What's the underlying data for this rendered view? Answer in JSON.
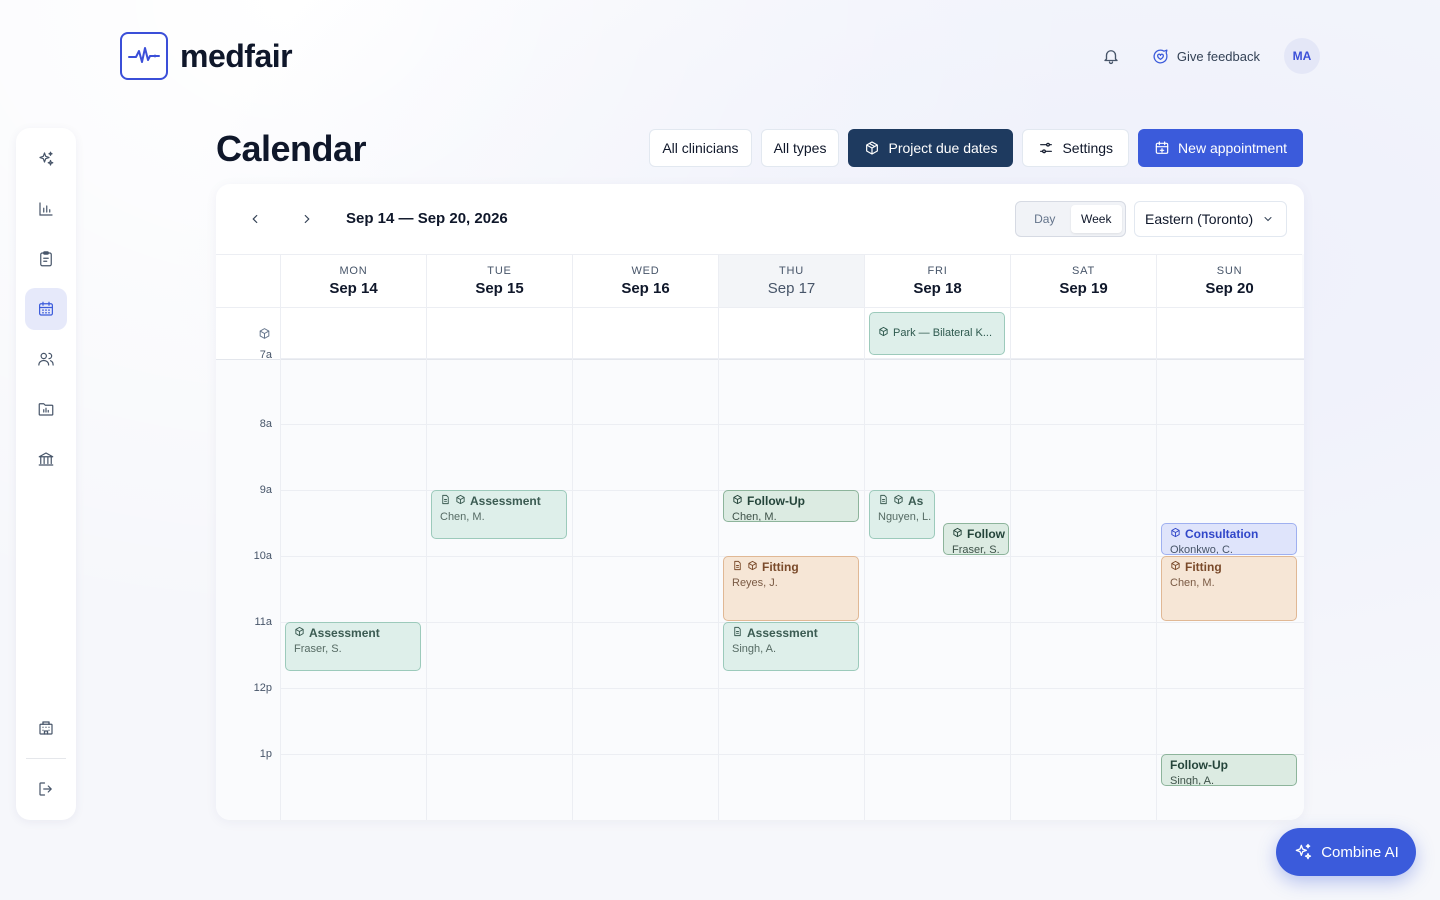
{
  "app": {
    "brand": "medfair"
  },
  "header": {
    "feedback_label": "Give feedback",
    "avatar_initials": "MA"
  },
  "page": {
    "title": "Calendar"
  },
  "toolbar": {
    "clinicians": "All clinicians",
    "types": "All types",
    "project_due": "Project due dates",
    "settings": "Settings",
    "new_appointment": "New appointment"
  },
  "calendar": {
    "range": "Sep 14 — Sep 20, 2026",
    "view_day": "Day",
    "view_week": "Week",
    "active_view": "Week",
    "timezone": "Eastern (Toronto)",
    "days": [
      {
        "name": "MON",
        "date": "Sep 14"
      },
      {
        "name": "TUE",
        "date": "Sep 15"
      },
      {
        "name": "WED",
        "date": "Sep 16"
      },
      {
        "name": "THU",
        "date": "Sep 17",
        "today": true
      },
      {
        "name": "FRI",
        "date": "Sep 18"
      },
      {
        "name": "SAT",
        "date": "Sep 19"
      },
      {
        "name": "SUN",
        "date": "Sep 20"
      }
    ],
    "hours": [
      "7a",
      "8a",
      "9a",
      "10a",
      "11a",
      "12p",
      "1p"
    ],
    "all_day_events": [
      {
        "day": "FRI",
        "title": "Park — Bilateral K..."
      }
    ],
    "events": [
      {
        "day": "MON",
        "title": "Assessment",
        "person": "Fraser, S.",
        "start": "11:00",
        "end": "11:45",
        "color": "teal",
        "icons": [
          "package"
        ]
      },
      {
        "day": "TUE",
        "title": "Assessment",
        "person": "Chen, M.",
        "start": "9:00",
        "end": "9:45",
        "color": "teal",
        "icons": [
          "document",
          "package"
        ]
      },
      {
        "day": "THU",
        "title": "Follow-Up",
        "person": "Chen, M.",
        "start": "9:00",
        "end": "9:30",
        "color": "green",
        "icons": [
          "package"
        ]
      },
      {
        "day": "THU",
        "title": "Fitting",
        "person": "Reyes, J.",
        "start": "10:00",
        "end": "11:00",
        "color": "peach",
        "icons": [
          "document",
          "package"
        ]
      },
      {
        "day": "THU",
        "title": "Assessment",
        "person": "Singh, A.",
        "start": "11:00",
        "end": "11:45",
        "color": "teal",
        "icons": [
          "document"
        ]
      },
      {
        "day": "FRI",
        "title": "As",
        "person": "Nguyen, L.",
        "start": "9:00",
        "end": "9:45",
        "color": "teal",
        "icons": [
          "document",
          "package"
        ]
      },
      {
        "day": "FRI",
        "title": "Follow",
        "person": "Fraser, S.",
        "start": "9:30",
        "end": "10:00",
        "color": "green",
        "icons": [
          "package"
        ]
      },
      {
        "day": "SUN",
        "title": "Consultation",
        "person": "Okonkwo, C.",
        "start": "9:30",
        "end": "10:00",
        "color": "blue",
        "icons": [
          "package"
        ]
      },
      {
        "day": "SUN",
        "title": "Fitting",
        "person": "Chen, M.",
        "start": "10:00",
        "end": "11:00",
        "color": "peach",
        "icons": [
          "package"
        ]
      },
      {
        "day": "SUN",
        "title": "Follow-Up",
        "person": "Singh, A.",
        "start": "13:00",
        "end": "13:30",
        "color": "green",
        "icons": []
      }
    ]
  },
  "sidebar": {
    "items": [
      {
        "icon": "sparkles-icon"
      },
      {
        "icon": "bar-chart-icon"
      },
      {
        "icon": "clipboard-icon"
      },
      {
        "icon": "calendar-icon",
        "active": true
      },
      {
        "icon": "users-icon"
      },
      {
        "icon": "folder-chart-icon"
      },
      {
        "icon": "bank-icon"
      }
    ],
    "bottom": [
      {
        "icon": "building-icon"
      },
      {
        "icon": "logout-icon"
      }
    ]
  },
  "assistant": {
    "label": "Combine AI"
  },
  "colors": {
    "accent": "#3b5bdb",
    "dark": "#1e3a5f",
    "teal": "#deefea",
    "peach": "#f6e6d6",
    "lavender": "#dfe4fb"
  }
}
